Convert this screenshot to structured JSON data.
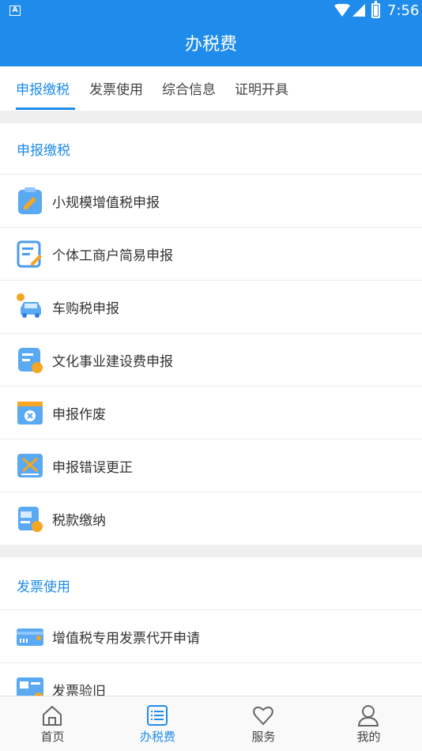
{
  "status_bar": {
    "time": "7:56"
  },
  "header": {
    "title": "办税费"
  },
  "tabs": [
    {
      "label": "申报缴税",
      "active": true
    },
    {
      "label": "发票使用",
      "active": false
    },
    {
      "label": "综合信息",
      "active": false
    },
    {
      "label": "证明开具",
      "active": false
    }
  ],
  "sections": [
    {
      "title": "申报缴税",
      "items": [
        {
          "label": "小规模增值税申报",
          "icon": "clipboard-edit-icon"
        },
        {
          "label": "个体工商户简易申报",
          "icon": "document-edit-icon"
        },
        {
          "label": "车购税申报",
          "icon": "car-icon"
        },
        {
          "label": "文化事业建设费申报",
          "icon": "document-coin-icon"
        },
        {
          "label": "申报作废",
          "icon": "cancel-window-icon"
        },
        {
          "label": "申报错误更正",
          "icon": "correction-icon"
        },
        {
          "label": "税款缴纳",
          "icon": "tax-payment-icon"
        }
      ]
    },
    {
      "title": "发票使用",
      "items": [
        {
          "label": "增值税专用发票代开申请",
          "icon": "invoice-card-icon"
        },
        {
          "label": "发票验旧",
          "icon": "invoice-verify-icon"
        }
      ]
    }
  ],
  "bottom_nav": [
    {
      "label": "首页",
      "icon": "home-icon",
      "active": false
    },
    {
      "label": "办税费",
      "icon": "list-icon",
      "active": true
    },
    {
      "label": "服务",
      "icon": "heart-icon",
      "active": false
    },
    {
      "label": "我的",
      "icon": "user-icon",
      "active": false
    }
  ],
  "colors": {
    "primary": "#1f8ceb",
    "accent": "#f5a623"
  }
}
